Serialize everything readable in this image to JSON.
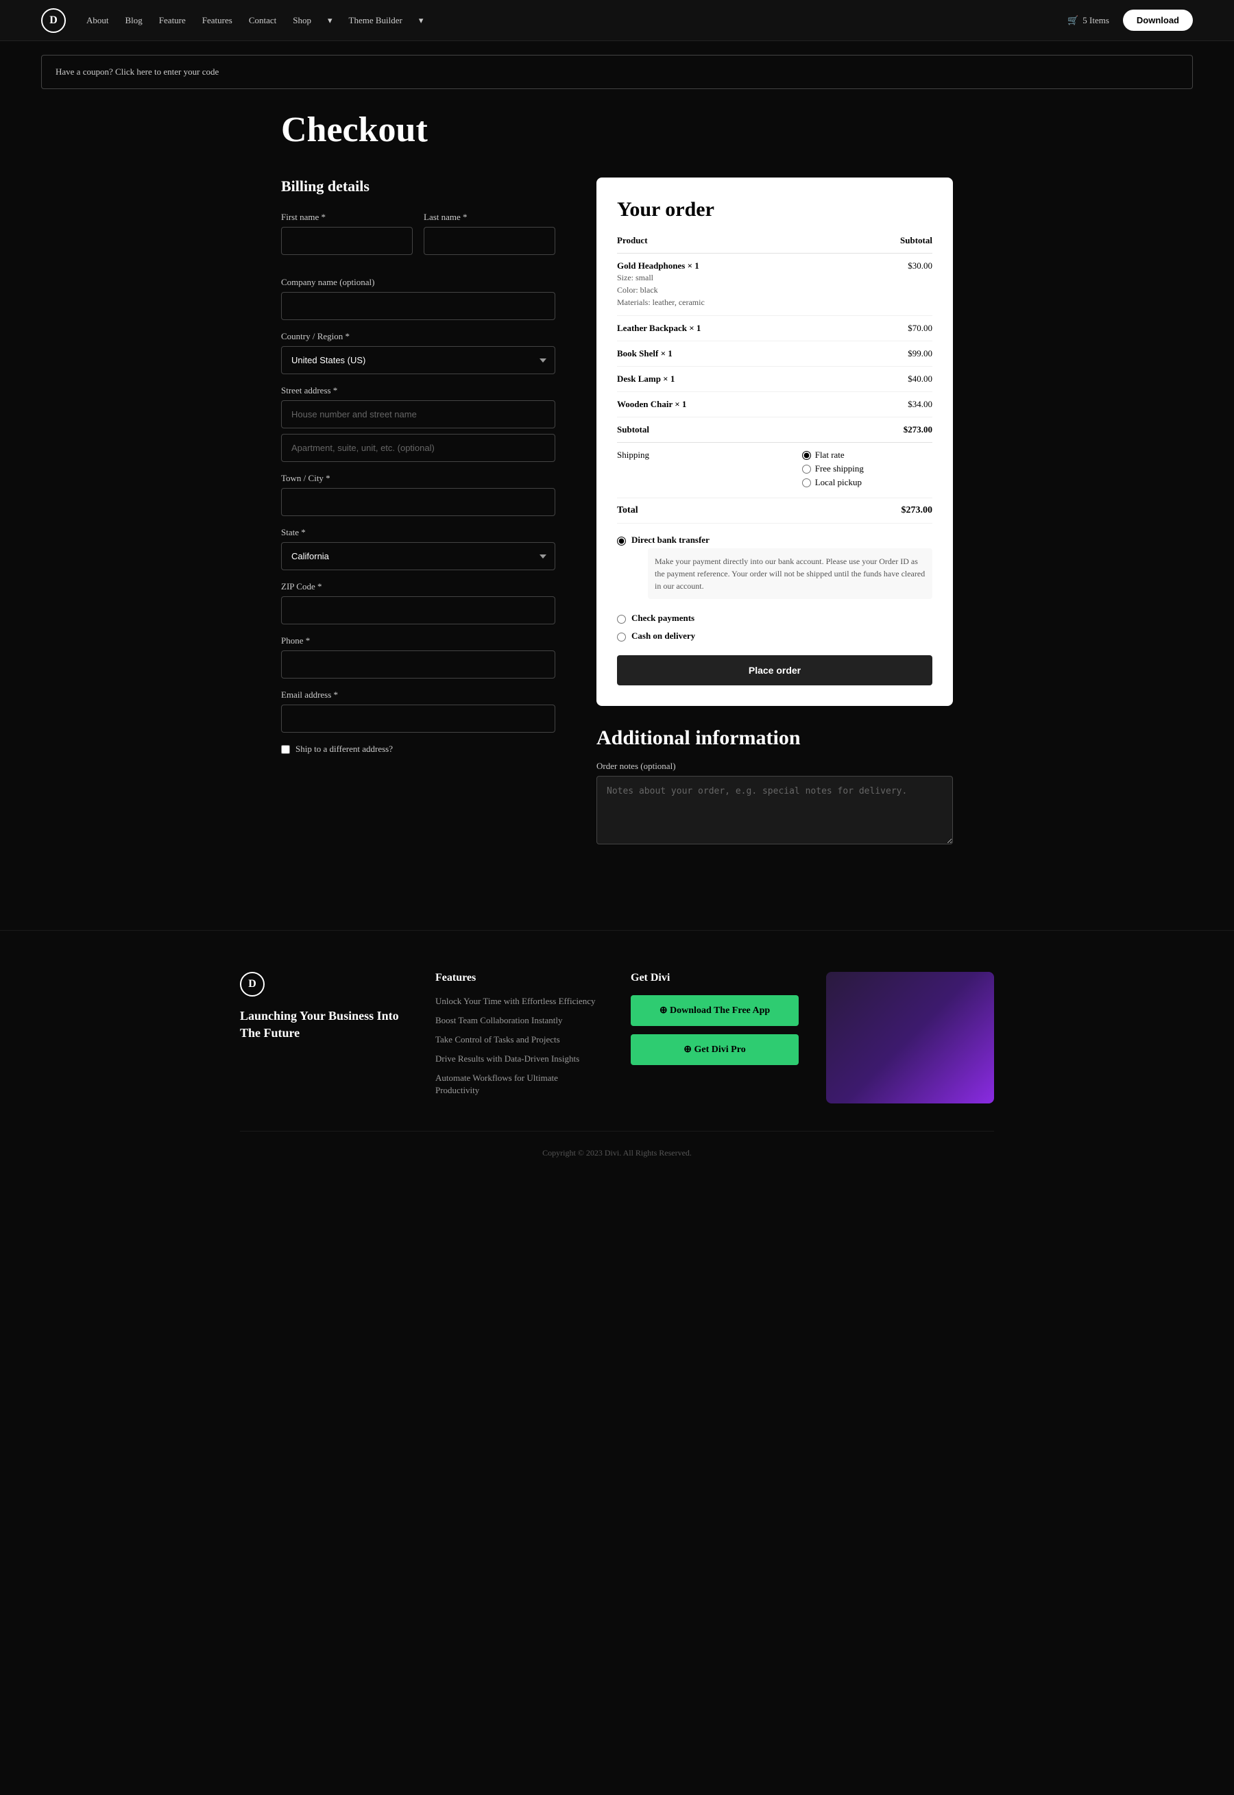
{
  "nav": {
    "logo": "D",
    "links": [
      {
        "label": "About"
      },
      {
        "label": "Blog"
      },
      {
        "label": "Feature"
      },
      {
        "label": "Features"
      },
      {
        "label": "Contact"
      },
      {
        "label": "Shop"
      },
      {
        "label": "Theme Builder"
      }
    ],
    "cart_label": "5 Items",
    "download_label": "Download"
  },
  "coupon": {
    "text": "Have a coupon? Click here to enter your code"
  },
  "checkout": {
    "title": "Checkout"
  },
  "billing": {
    "title": "Billing details",
    "first_name_label": "First name *",
    "last_name_label": "Last name *",
    "company_label": "Company name (optional)",
    "country_label": "Country / Region *",
    "country_value": "United States (US)",
    "street_label": "Street address *",
    "street_placeholder": "House number and street name",
    "apt_placeholder": "Apartment, suite, unit, etc. (optional)",
    "city_label": "Town / City *",
    "state_label": "State *",
    "state_value": "California",
    "zip_label": "ZIP Code *",
    "phone_label": "Phone *",
    "email_label": "Email address *",
    "ship_different": "Ship to a different address?"
  },
  "order": {
    "title": "Your order",
    "col_product": "Product",
    "col_subtotal": "Subtotal",
    "items": [
      {
        "name": "Gold Headphones",
        "qty": "× 1",
        "details": "Size: small\nColor: black\nMaterials: leather, ceramic",
        "price": "$30.00"
      },
      {
        "name": "Leather Backpack",
        "qty": "× 1",
        "details": "",
        "price": "$70.00"
      },
      {
        "name": "Book Shelf",
        "qty": "× 1",
        "details": "",
        "price": "$99.00"
      },
      {
        "name": "Desk Lamp",
        "qty": "× 1",
        "details": "",
        "price": "$40.00"
      },
      {
        "name": "Wooden Chair",
        "qty": "× 1",
        "details": "",
        "price": "$34.00"
      }
    ],
    "subtotal_label": "Subtotal",
    "subtotal_value": "$273.00",
    "shipping_label": "Shipping",
    "shipping_options": [
      {
        "label": "Flat rate",
        "selected": true
      },
      {
        "label": "Free shipping",
        "selected": false
      },
      {
        "label": "Local pickup",
        "selected": false
      }
    ],
    "total_label": "Total",
    "total_value": "$273.00",
    "payment_options": [
      {
        "label": "Direct bank transfer",
        "selected": true,
        "desc": "Make your payment directly into our bank account. Please use your Order ID as the payment reference. Your order will not be shipped until the funds have cleared in our account."
      },
      {
        "label": "Check payments",
        "selected": false,
        "desc": ""
      },
      {
        "label": "Cash on delivery",
        "selected": false,
        "desc": ""
      }
    ],
    "place_order_label": "Place order"
  },
  "additional": {
    "title": "Additional information",
    "notes_label": "Order notes (optional)",
    "notes_placeholder": "Notes about your order, e.g. special notes for delivery."
  },
  "footer": {
    "logo": "D",
    "tagline": "Launching Your Business Into The Future",
    "features_title": "Features",
    "feature_links": [
      "Unlock Your Time with Effortless Efficiency",
      "Boost Team Collaboration Instantly",
      "Take Control of Tasks and Projects",
      "Drive Results with Data-Driven Insights",
      "Automate Workflows for Ultimate Productivity"
    ],
    "get_divi_title": "Get Divi",
    "download_btn": "⊕ Download The Free App",
    "pro_btn": "⊕ Get Divi Pro",
    "copyright": "Copyright © 2023 Divi. All Rights Reserved."
  }
}
